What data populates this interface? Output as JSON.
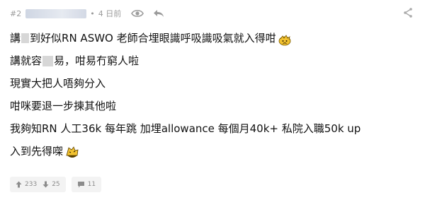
{
  "header": {
    "floor": "#2",
    "separator": "•",
    "time": "4 日前",
    "icons": [
      "eye-icon",
      "reply-icon",
      "share-icon"
    ]
  },
  "content": {
    "lines": [
      {
        "a": "講",
        "b": "到好似RN ASWO 老師合埋眼識呼吸識吸氣就入得咁"
      },
      {
        "a": "講就容",
        "b": "易，咁易冇窮人啦"
      },
      {
        "text": "現實大把人唔夠分入"
      },
      {
        "text": "咁咪要退一步揀其他啦"
      },
      {
        "text": "我夠知RN 人工36k 每年跳 加埋allowance 每個月40k+ 私院入職50k up"
      },
      {
        "text": "入到先得㗎"
      }
    ]
  },
  "footer": {
    "upvotes": "233",
    "downvotes": "25",
    "comments": "11"
  },
  "colors": {
    "meta": "#9b9b9b",
    "pill_bg": "#f3f3f3",
    "pill_text": "#8c8c8c",
    "emoji_yellow": "#f2c230"
  }
}
